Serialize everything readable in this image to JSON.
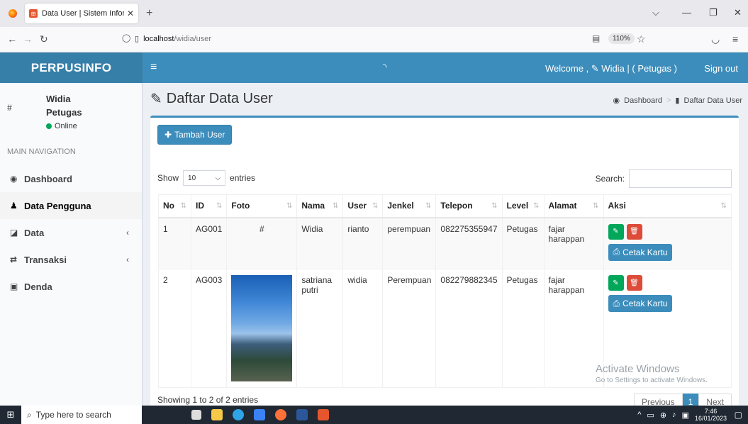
{
  "browser": {
    "tab_title": "Data User | Sistem Informasi Per",
    "tab_favicon": "⊞",
    "url_host": "localhost",
    "url_path": "/widia/user",
    "zoom": "110%"
  },
  "header": {
    "logo": "PERPUSINFO",
    "welcome": "Welcome , ✎ Widia | ( Petugas )",
    "signout": "Sign out"
  },
  "sidebar": {
    "avatar_placeholder": "#",
    "user_name": "Widia",
    "user_role": "Petugas",
    "status": "Online",
    "nav_header": "MAIN NAVIGATION",
    "items": [
      {
        "label": "Dashboard",
        "icon": "dashboard-icon"
      },
      {
        "label": "Data Pengguna",
        "icon": "user-icon"
      },
      {
        "label": "Data",
        "icon": "edit-icon"
      },
      {
        "label": "Transaksi",
        "icon": "exchange-icon"
      },
      {
        "label": "Denda",
        "icon": "money-icon"
      }
    ]
  },
  "content": {
    "title": "Daftar Data User",
    "breadcrumb": [
      "Dashboard",
      "Daftar Data User"
    ],
    "add_button": "Tambah User",
    "show_label": "Show",
    "entries_value": "10",
    "entries_label": "entries",
    "search_label": "Search:",
    "columns": [
      "No",
      "ID",
      "Foto",
      "Nama",
      "User",
      "Jenkel",
      "Telepon",
      "Level",
      "Alamat",
      "Aksi"
    ],
    "rows": [
      {
        "no": "1",
        "id": "AG001",
        "foto": "#",
        "nama": "Widia",
        "user": "rianto",
        "jenkel": "perempuan",
        "telepon": "082275355947",
        "level": "Petugas",
        "alamat": "fajar harappan"
      },
      {
        "no": "2",
        "id": "AG003",
        "foto": "",
        "nama": "satriana putri",
        "user": "widia",
        "jenkel": "Perempuan",
        "telepon": "082279882345",
        "level": "Petugas",
        "alamat": "fajar harappan"
      }
    ],
    "print_button": "Cetak Kartu",
    "showing": "Showing 1 to 2 of 2 entries",
    "pager": {
      "prev": "Previous",
      "current": "1",
      "next": "Next"
    }
  },
  "watermark": {
    "title": "Activate Windows",
    "subtitle": "Go to Settings to activate Windows."
  },
  "taskbar": {
    "search_placeholder": "Type here to search",
    "time": "7:46",
    "date": "16/01/2023"
  }
}
